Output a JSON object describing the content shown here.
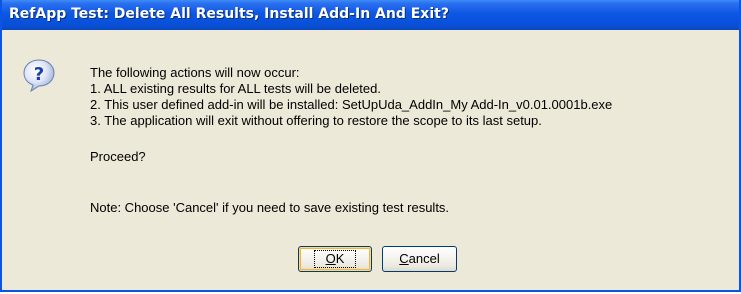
{
  "dialog": {
    "title": "RefApp Test: Delete All Results, Install Add-In And Exit?",
    "icon": "question-icon",
    "message_lines": [
      "The following actions will now occur:",
      "1. ALL existing results for ALL tests will be deleted.",
      "2. This user defined add-in will be installed: SetUpUda_AddIn_My Add-In_v0.01.0001b.exe",
      "3. The application will exit without offering to restore the scope to its last setup."
    ],
    "proceed": "Proceed?",
    "note": "Note: Choose 'Cancel' if you need to save existing test results.",
    "buttons": {
      "ok": {
        "access_key": "O",
        "rest": "K"
      },
      "cancel": {
        "access_key": "C",
        "rest": "ancel"
      }
    }
  },
  "colors": {
    "titlebar": "#0852dd",
    "dialog_bg": "#ece9d8",
    "border": "#0a54e6"
  }
}
